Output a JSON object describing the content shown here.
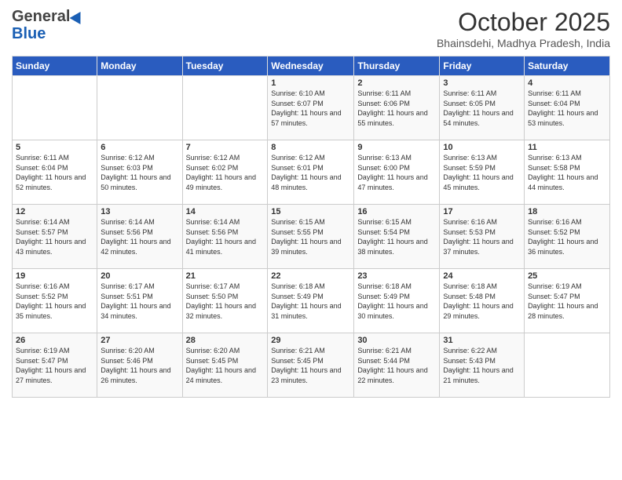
{
  "header": {
    "logo_general": "General",
    "logo_blue": "Blue",
    "title": "October 2025",
    "subtitle": "Bhainsdehi, Madhya Pradesh, India"
  },
  "weekdays": [
    "Sunday",
    "Monday",
    "Tuesday",
    "Wednesday",
    "Thursday",
    "Friday",
    "Saturday"
  ],
  "weeks": [
    [
      {
        "day": "",
        "sunrise": "",
        "sunset": "",
        "daylight": ""
      },
      {
        "day": "",
        "sunrise": "",
        "sunset": "",
        "daylight": ""
      },
      {
        "day": "",
        "sunrise": "",
        "sunset": "",
        "daylight": ""
      },
      {
        "day": "1",
        "sunrise": "Sunrise: 6:10 AM",
        "sunset": "Sunset: 6:07 PM",
        "daylight": "Daylight: 11 hours and 57 minutes."
      },
      {
        "day": "2",
        "sunrise": "Sunrise: 6:11 AM",
        "sunset": "Sunset: 6:06 PM",
        "daylight": "Daylight: 11 hours and 55 minutes."
      },
      {
        "day": "3",
        "sunrise": "Sunrise: 6:11 AM",
        "sunset": "Sunset: 6:05 PM",
        "daylight": "Daylight: 11 hours and 54 minutes."
      },
      {
        "day": "4",
        "sunrise": "Sunrise: 6:11 AM",
        "sunset": "Sunset: 6:04 PM",
        "daylight": "Daylight: 11 hours and 53 minutes."
      }
    ],
    [
      {
        "day": "5",
        "sunrise": "Sunrise: 6:11 AM",
        "sunset": "Sunset: 6:04 PM",
        "daylight": "Daylight: 11 hours and 52 minutes."
      },
      {
        "day": "6",
        "sunrise": "Sunrise: 6:12 AM",
        "sunset": "Sunset: 6:03 PM",
        "daylight": "Daylight: 11 hours and 50 minutes."
      },
      {
        "day": "7",
        "sunrise": "Sunrise: 6:12 AM",
        "sunset": "Sunset: 6:02 PM",
        "daylight": "Daylight: 11 hours and 49 minutes."
      },
      {
        "day": "8",
        "sunrise": "Sunrise: 6:12 AM",
        "sunset": "Sunset: 6:01 PM",
        "daylight": "Daylight: 11 hours and 48 minutes."
      },
      {
        "day": "9",
        "sunrise": "Sunrise: 6:13 AM",
        "sunset": "Sunset: 6:00 PM",
        "daylight": "Daylight: 11 hours and 47 minutes."
      },
      {
        "day": "10",
        "sunrise": "Sunrise: 6:13 AM",
        "sunset": "Sunset: 5:59 PM",
        "daylight": "Daylight: 11 hours and 45 minutes."
      },
      {
        "day": "11",
        "sunrise": "Sunrise: 6:13 AM",
        "sunset": "Sunset: 5:58 PM",
        "daylight": "Daylight: 11 hours and 44 minutes."
      }
    ],
    [
      {
        "day": "12",
        "sunrise": "Sunrise: 6:14 AM",
        "sunset": "Sunset: 5:57 PM",
        "daylight": "Daylight: 11 hours and 43 minutes."
      },
      {
        "day": "13",
        "sunrise": "Sunrise: 6:14 AM",
        "sunset": "Sunset: 5:56 PM",
        "daylight": "Daylight: 11 hours and 42 minutes."
      },
      {
        "day": "14",
        "sunrise": "Sunrise: 6:14 AM",
        "sunset": "Sunset: 5:56 PM",
        "daylight": "Daylight: 11 hours and 41 minutes."
      },
      {
        "day": "15",
        "sunrise": "Sunrise: 6:15 AM",
        "sunset": "Sunset: 5:55 PM",
        "daylight": "Daylight: 11 hours and 39 minutes."
      },
      {
        "day": "16",
        "sunrise": "Sunrise: 6:15 AM",
        "sunset": "Sunset: 5:54 PM",
        "daylight": "Daylight: 11 hours and 38 minutes."
      },
      {
        "day": "17",
        "sunrise": "Sunrise: 6:16 AM",
        "sunset": "Sunset: 5:53 PM",
        "daylight": "Daylight: 11 hours and 37 minutes."
      },
      {
        "day": "18",
        "sunrise": "Sunrise: 6:16 AM",
        "sunset": "Sunset: 5:52 PM",
        "daylight": "Daylight: 11 hours and 36 minutes."
      }
    ],
    [
      {
        "day": "19",
        "sunrise": "Sunrise: 6:16 AM",
        "sunset": "Sunset: 5:52 PM",
        "daylight": "Daylight: 11 hours and 35 minutes."
      },
      {
        "day": "20",
        "sunrise": "Sunrise: 6:17 AM",
        "sunset": "Sunset: 5:51 PM",
        "daylight": "Daylight: 11 hours and 34 minutes."
      },
      {
        "day": "21",
        "sunrise": "Sunrise: 6:17 AM",
        "sunset": "Sunset: 5:50 PM",
        "daylight": "Daylight: 11 hours and 32 minutes."
      },
      {
        "day": "22",
        "sunrise": "Sunrise: 6:18 AM",
        "sunset": "Sunset: 5:49 PM",
        "daylight": "Daylight: 11 hours and 31 minutes."
      },
      {
        "day": "23",
        "sunrise": "Sunrise: 6:18 AM",
        "sunset": "Sunset: 5:49 PM",
        "daylight": "Daylight: 11 hours and 30 minutes."
      },
      {
        "day": "24",
        "sunrise": "Sunrise: 6:18 AM",
        "sunset": "Sunset: 5:48 PM",
        "daylight": "Daylight: 11 hours and 29 minutes."
      },
      {
        "day": "25",
        "sunrise": "Sunrise: 6:19 AM",
        "sunset": "Sunset: 5:47 PM",
        "daylight": "Daylight: 11 hours and 28 minutes."
      }
    ],
    [
      {
        "day": "26",
        "sunrise": "Sunrise: 6:19 AM",
        "sunset": "Sunset: 5:47 PM",
        "daylight": "Daylight: 11 hours and 27 minutes."
      },
      {
        "day": "27",
        "sunrise": "Sunrise: 6:20 AM",
        "sunset": "Sunset: 5:46 PM",
        "daylight": "Daylight: 11 hours and 26 minutes."
      },
      {
        "day": "28",
        "sunrise": "Sunrise: 6:20 AM",
        "sunset": "Sunset: 5:45 PM",
        "daylight": "Daylight: 11 hours and 24 minutes."
      },
      {
        "day": "29",
        "sunrise": "Sunrise: 6:21 AM",
        "sunset": "Sunset: 5:45 PM",
        "daylight": "Daylight: 11 hours and 23 minutes."
      },
      {
        "day": "30",
        "sunrise": "Sunrise: 6:21 AM",
        "sunset": "Sunset: 5:44 PM",
        "daylight": "Daylight: 11 hours and 22 minutes."
      },
      {
        "day": "31",
        "sunrise": "Sunrise: 6:22 AM",
        "sunset": "Sunset: 5:43 PM",
        "daylight": "Daylight: 11 hours and 21 minutes."
      },
      {
        "day": "",
        "sunrise": "",
        "sunset": "",
        "daylight": ""
      }
    ]
  ]
}
